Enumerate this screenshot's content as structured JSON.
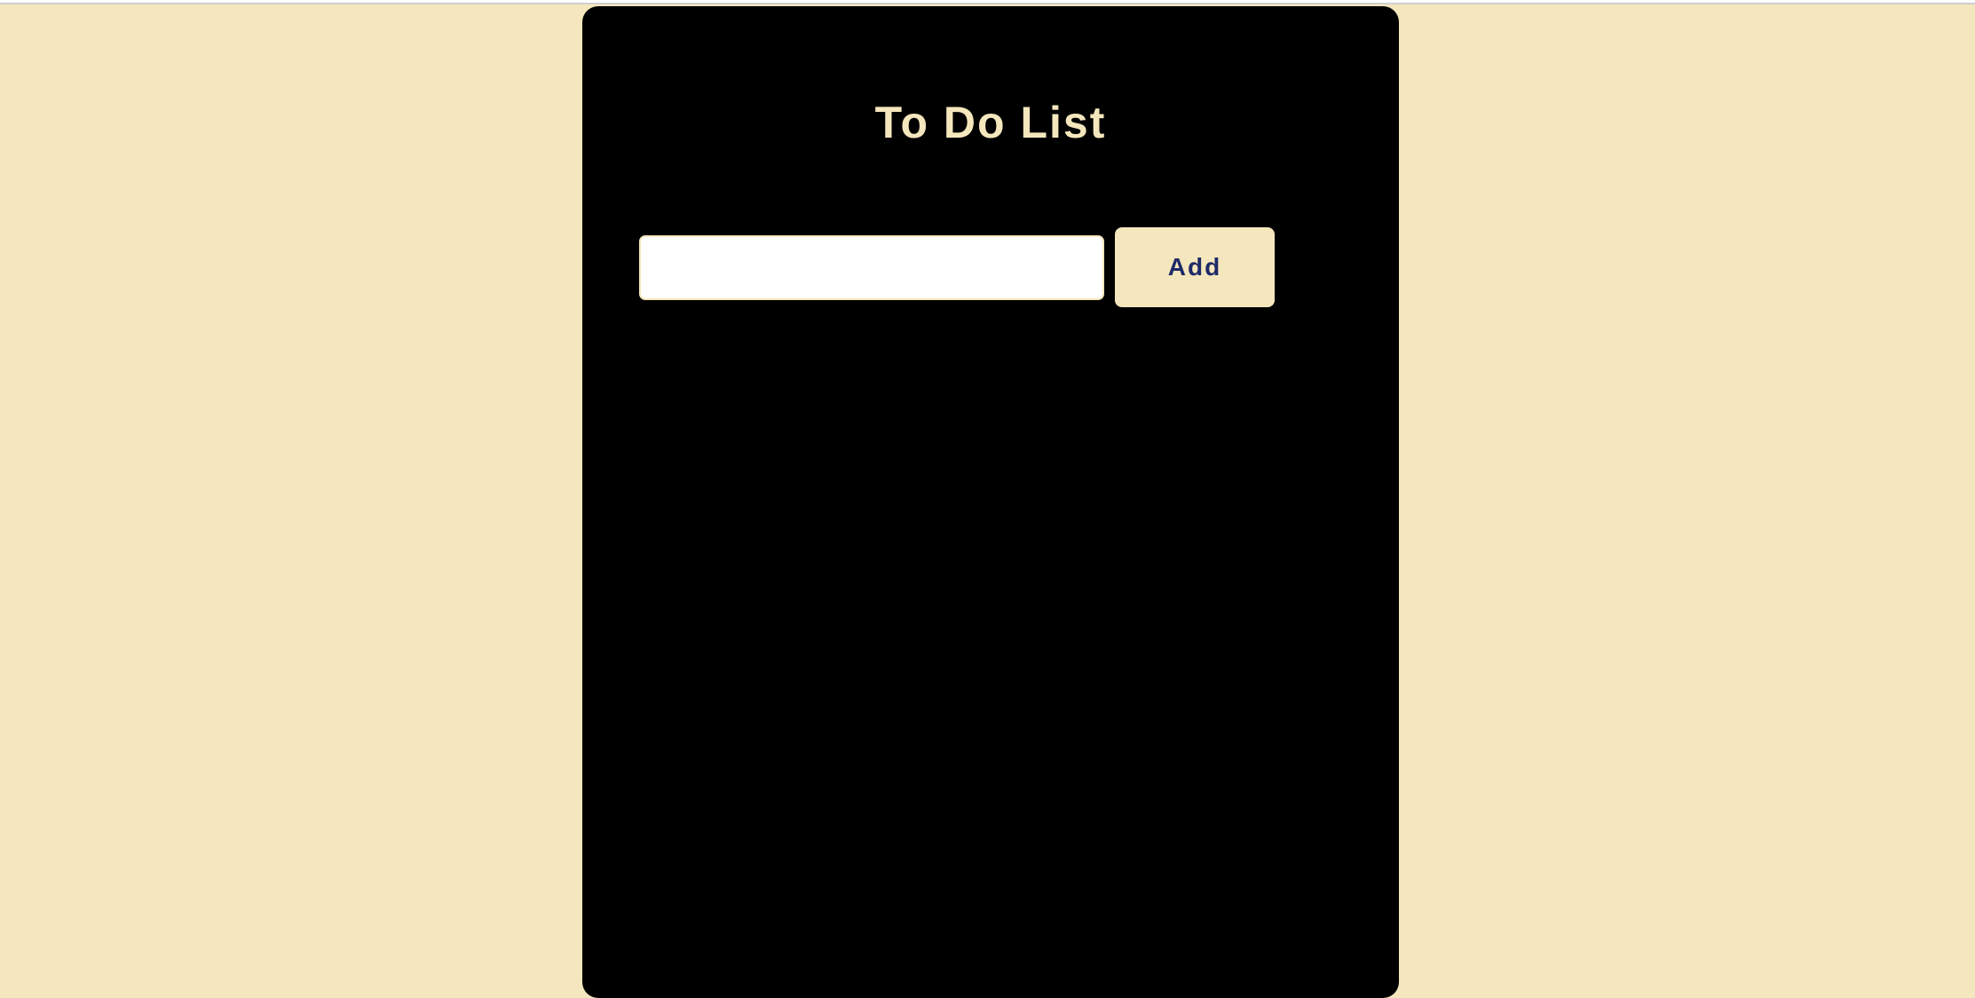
{
  "app": {
    "title": "To Do List"
  },
  "input": {
    "value": "",
    "placeholder": ""
  },
  "add_button": {
    "label": "Add"
  },
  "tasks": [],
  "colors": {
    "background": "#f5e7bd",
    "card": "#000000",
    "title": "#f5e7bd",
    "button_background": "#f5e7bd",
    "button_text": "#1f2a68",
    "input_background": "#ffffff"
  }
}
